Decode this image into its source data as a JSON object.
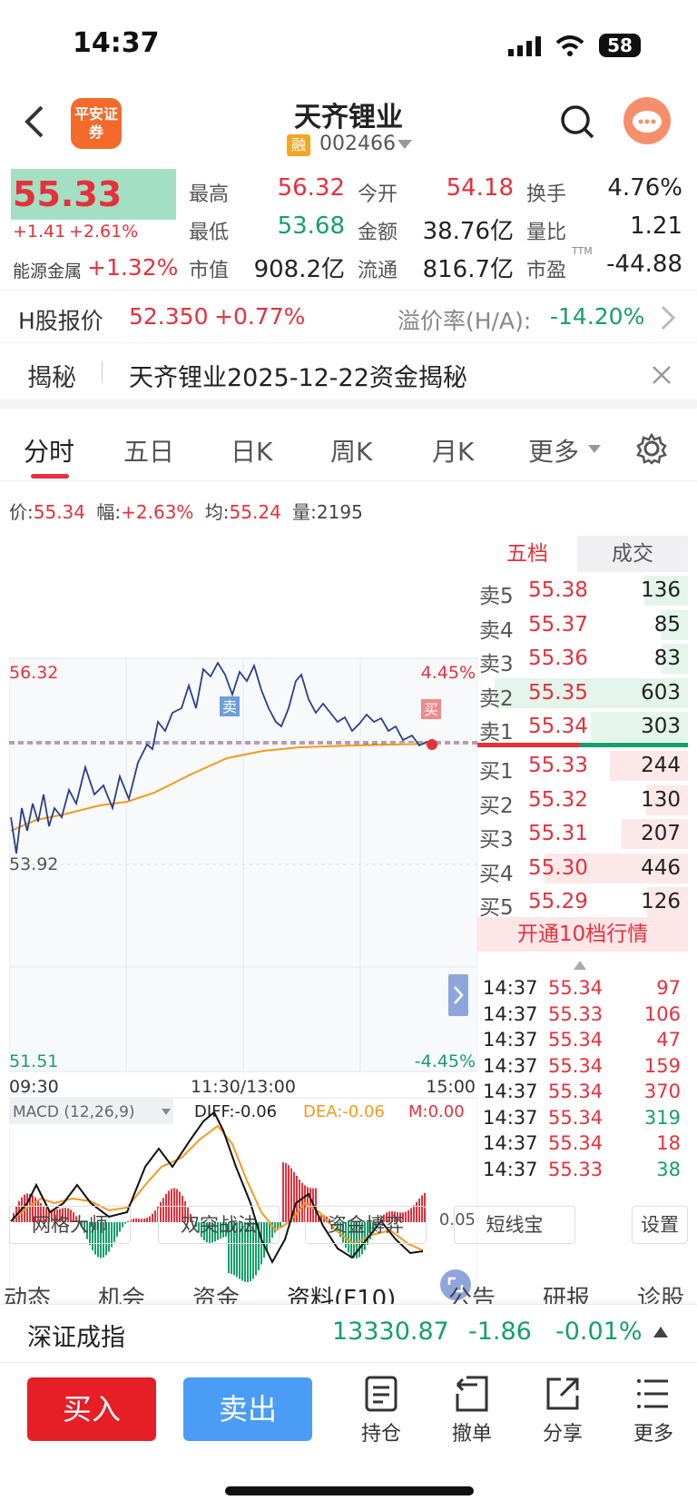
{
  "status_bar": {
    "time": "14:37",
    "battery": "58"
  },
  "header": {
    "title": "天齐锂业",
    "code": "002466",
    "margin_badge": "融",
    "broker_logo": "平安证券"
  },
  "quote": {
    "price": "55.33",
    "change": "+1.41",
    "change_pct": "+2.61%",
    "sector_name": "能源金属",
    "sector_pct": "+1.32%",
    "stats": [
      {
        "label": "最高",
        "value": "56.32",
        "color": "red"
      },
      {
        "label": "今开",
        "value": "54.18",
        "color": "red"
      },
      {
        "label": "换手",
        "value": "4.76%",
        "color": "black"
      },
      {
        "label": "最低",
        "value": "53.68",
        "color": "green"
      },
      {
        "label": "金额",
        "value": "38.76亿",
        "color": "black"
      },
      {
        "label": "量比",
        "value": "1.21",
        "color": "black"
      },
      {
        "label": "市值",
        "value": "908.2亿",
        "color": "black"
      },
      {
        "label": "流通",
        "value": "816.7亿",
        "color": "black"
      },
      {
        "label": "市盈",
        "value": "-44.88",
        "color": "black"
      }
    ],
    "pe_sup": "TTM"
  },
  "hshare": {
    "label": "H股报价",
    "price": "52.350",
    "pct": "+0.77%",
    "premium_label": "溢价率(H/A):",
    "premium": "-14.20%"
  },
  "reveal": {
    "tag": "揭秘",
    "text": "天齐锂业2025-12-22资金揭秘"
  },
  "tabs": [
    "分时",
    "五日",
    "日K",
    "周K",
    "月K",
    "更多"
  ],
  "info_line": {
    "price_label": "价:",
    "price": "55.34",
    "amp_label": "幅:",
    "amp": "+2.63%",
    "avg_label": "均:",
    "avg": "55.24",
    "vol_label": "量:",
    "vol": "2195"
  },
  "chart_labels": {
    "y_top": "56.32",
    "y_mid": "53.92",
    "y_bottom": "51.51",
    "pct_top": "4.45%",
    "pct_bottom": "-4.45%",
    "t_start": "09:30",
    "t_mid": "11:30/13:00",
    "t_end": "15:00",
    "sell_mark": "卖",
    "buy_mark": "买",
    "macd_title": "MACD (12,26,9)",
    "diff": "DIFF:-0.06",
    "dea": "DEA:-0.06",
    "m": "M:0.00",
    "macd_level": "0.05"
  },
  "order_book": {
    "tabs": [
      "五档",
      "成交"
    ],
    "asks": [
      {
        "label": "卖5",
        "price": "55.38",
        "vol": "136"
      },
      {
        "label": "卖4",
        "price": "55.37",
        "vol": "85"
      },
      {
        "label": "卖3",
        "price": "55.36",
        "vol": "83"
      },
      {
        "label": "卖2",
        "price": "55.35",
        "vol": "603"
      },
      {
        "label": "卖1",
        "price": "55.34",
        "vol": "303"
      }
    ],
    "bids": [
      {
        "label": "买1",
        "price": "55.33",
        "vol": "244"
      },
      {
        "label": "买2",
        "price": "55.32",
        "vol": "130"
      },
      {
        "label": "买3",
        "price": "55.31",
        "vol": "207"
      },
      {
        "label": "买4",
        "price": "55.30",
        "vol": "446"
      },
      {
        "label": "买5",
        "price": "55.29",
        "vol": "126"
      }
    ],
    "upgrade": "开通10档行情"
  },
  "trades": [
    {
      "time": "14:37",
      "price": "55.34",
      "vol": "97",
      "c": "red"
    },
    {
      "time": "14:37",
      "price": "55.33",
      "vol": "106",
      "c": "red"
    },
    {
      "time": "14:37",
      "price": "55.34",
      "vol": "47",
      "c": "red"
    },
    {
      "time": "14:37",
      "price": "55.34",
      "vol": "159",
      "c": "red"
    },
    {
      "time": "14:37",
      "price": "55.34",
      "vol": "370",
      "c": "red"
    },
    {
      "time": "14:37",
      "price": "55.34",
      "vol": "319",
      "c": "green"
    },
    {
      "time": "14:37",
      "price": "55.34",
      "vol": "18",
      "c": "red"
    },
    {
      "time": "14:37",
      "price": "55.33",
      "vol": "38",
      "c": "green"
    }
  ],
  "tools": [
    "网格大师",
    "双突战法",
    "资金博弈",
    "短线宝",
    "设置"
  ],
  "subtabs": [
    "动态",
    "机会",
    "资金",
    "资料(F10)",
    "公告",
    "研报",
    "诊股"
  ],
  "index_bar": {
    "name": "深证成指",
    "value": "13330.87",
    "chg": "-1.86",
    "pct": "-0.01%"
  },
  "bottom_bar": {
    "buy": "买入",
    "sell": "卖出",
    "actions": [
      {
        "label": "持仓",
        "icon": "holdings-icon"
      },
      {
        "label": "撤单",
        "icon": "cancel-order-icon"
      },
      {
        "label": "分享",
        "icon": "share-icon"
      },
      {
        "label": "更多",
        "icon": "more-icon"
      }
    ]
  },
  "colors": {
    "up": "#e8303a",
    "down": "#15a06b",
    "price_line": "#2a3f8f",
    "avg_line": "#f39a1e"
  }
}
